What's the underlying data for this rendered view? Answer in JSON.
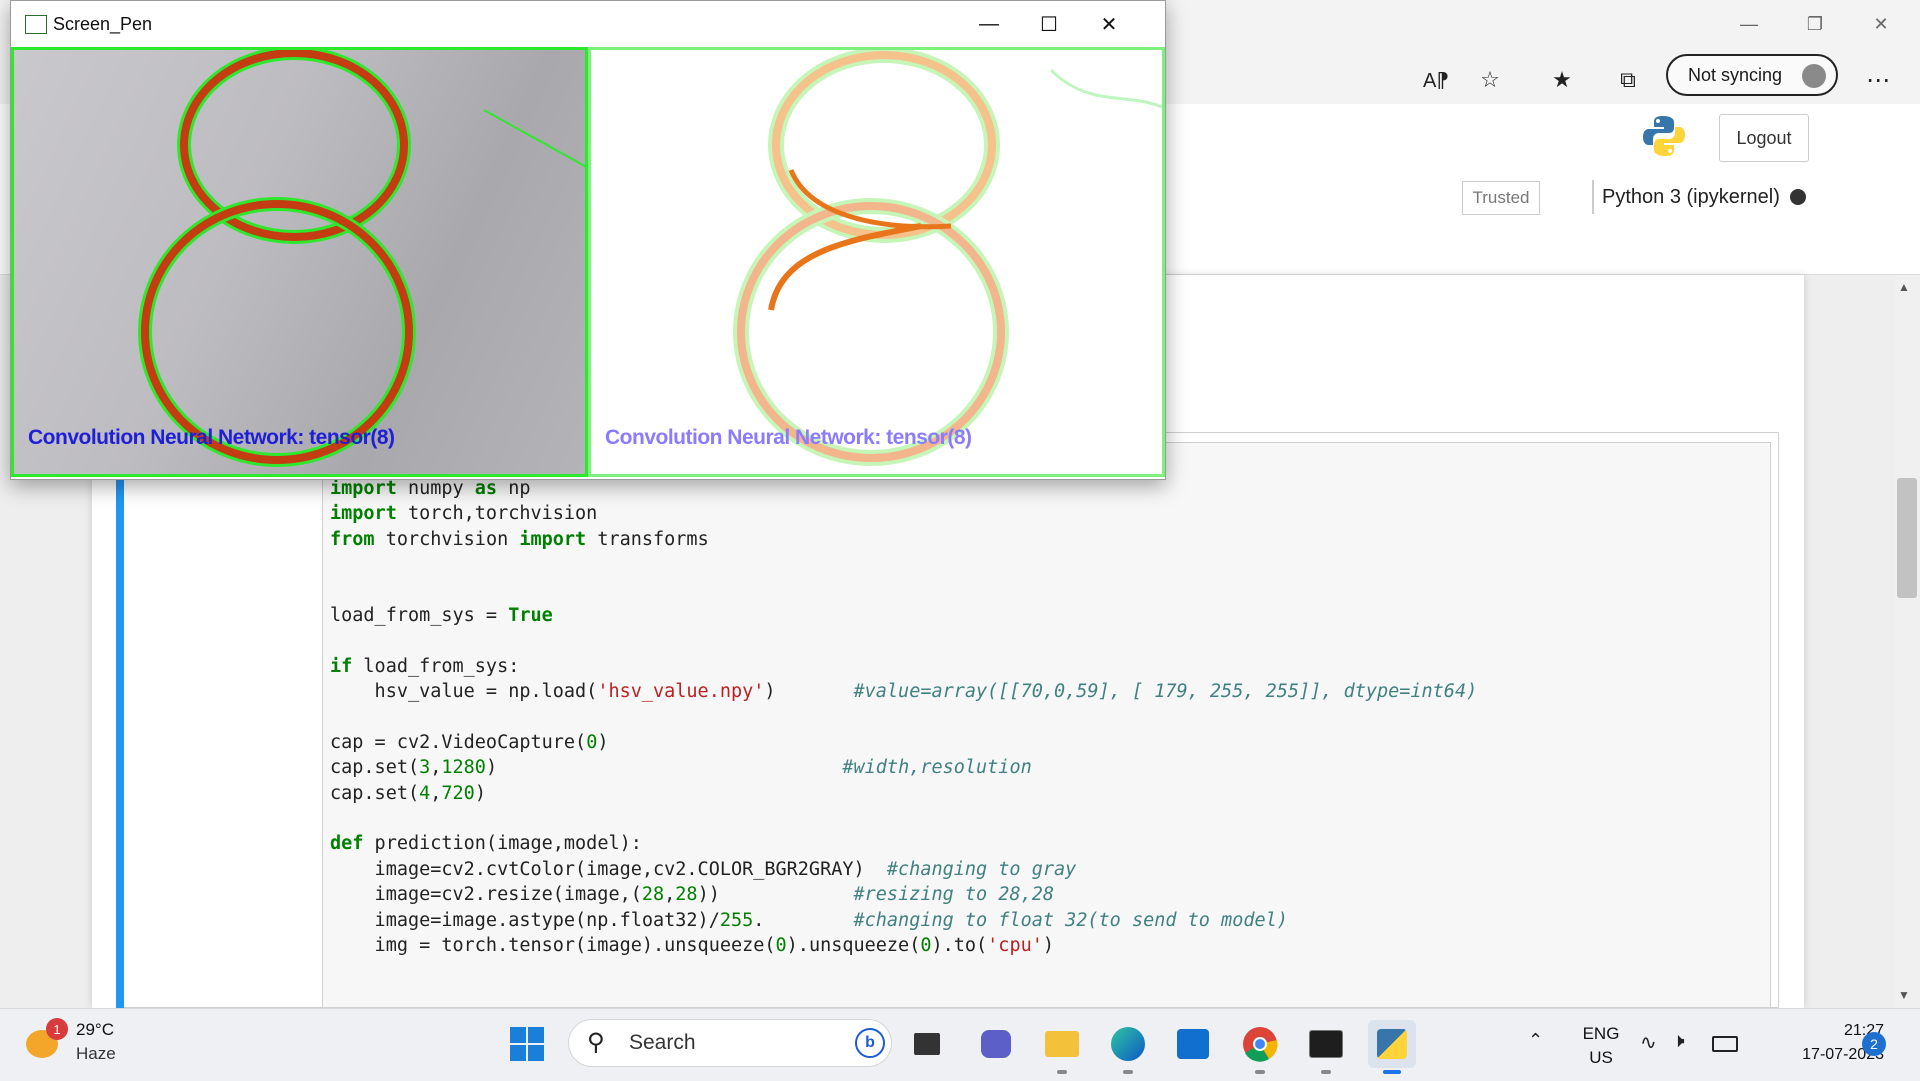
{
  "browser": {
    "sync_label": "Not syncing"
  },
  "jupyter": {
    "logout_label": "Logout",
    "trusted_label": "Trusted",
    "kernel_label": "Python 3 (ipykernel)"
  },
  "code_lines": [
    "import numpy as np",
    "import torch,torchvision",
    "from torchvision import transforms",
    "",
    "",
    "load_from_sys = True",
    "",
    "if load_from_sys:",
    "    hsv_value = np.load('hsv_value.npy')       #value=array([[70,0,59], [ 179, 255, 255]], dtype=int64)",
    "",
    "cap = cv2.VideoCapture(0)",
    "cap.set(3,1280)                               #width,resolution",
    "cap.set(4,720)",
    "",
    "def prediction(image,model):",
    "    image=cv2.cvtColor(image,cv2.COLOR_BGR2GRAY)  #changing to gray",
    "    image=cv2.resize(image,(28,28))            #resizing to 28,28",
    "    image=image.astype(np.float32)/255.        #changing to float 32(to send to model)",
    "    img = torch.tensor(image).unsqueeze(0).unsqueeze(0).to('cpu')"
  ],
  "pen_window": {
    "title": "Screen_Pen",
    "label_left": "Convolution  Neural  Network:   tensor(8)",
    "label_right": "Convolution  Neural  Network:   tensor(8)"
  },
  "taskbar": {
    "weather_temp": "29°C",
    "weather_desc": "Haze",
    "weather_badge": "1",
    "search_placeholder": "Search",
    "lang_top": "ENG",
    "lang_bottom": "US",
    "time": "21:27",
    "date": "17-07-2023",
    "notif_count": "2"
  },
  "colors": {
    "cell_accent": "#2196f3",
    "detect_green": "#2ee82e",
    "stroke_orange": "#d84315",
    "label_blue": "#1f1fd8"
  }
}
